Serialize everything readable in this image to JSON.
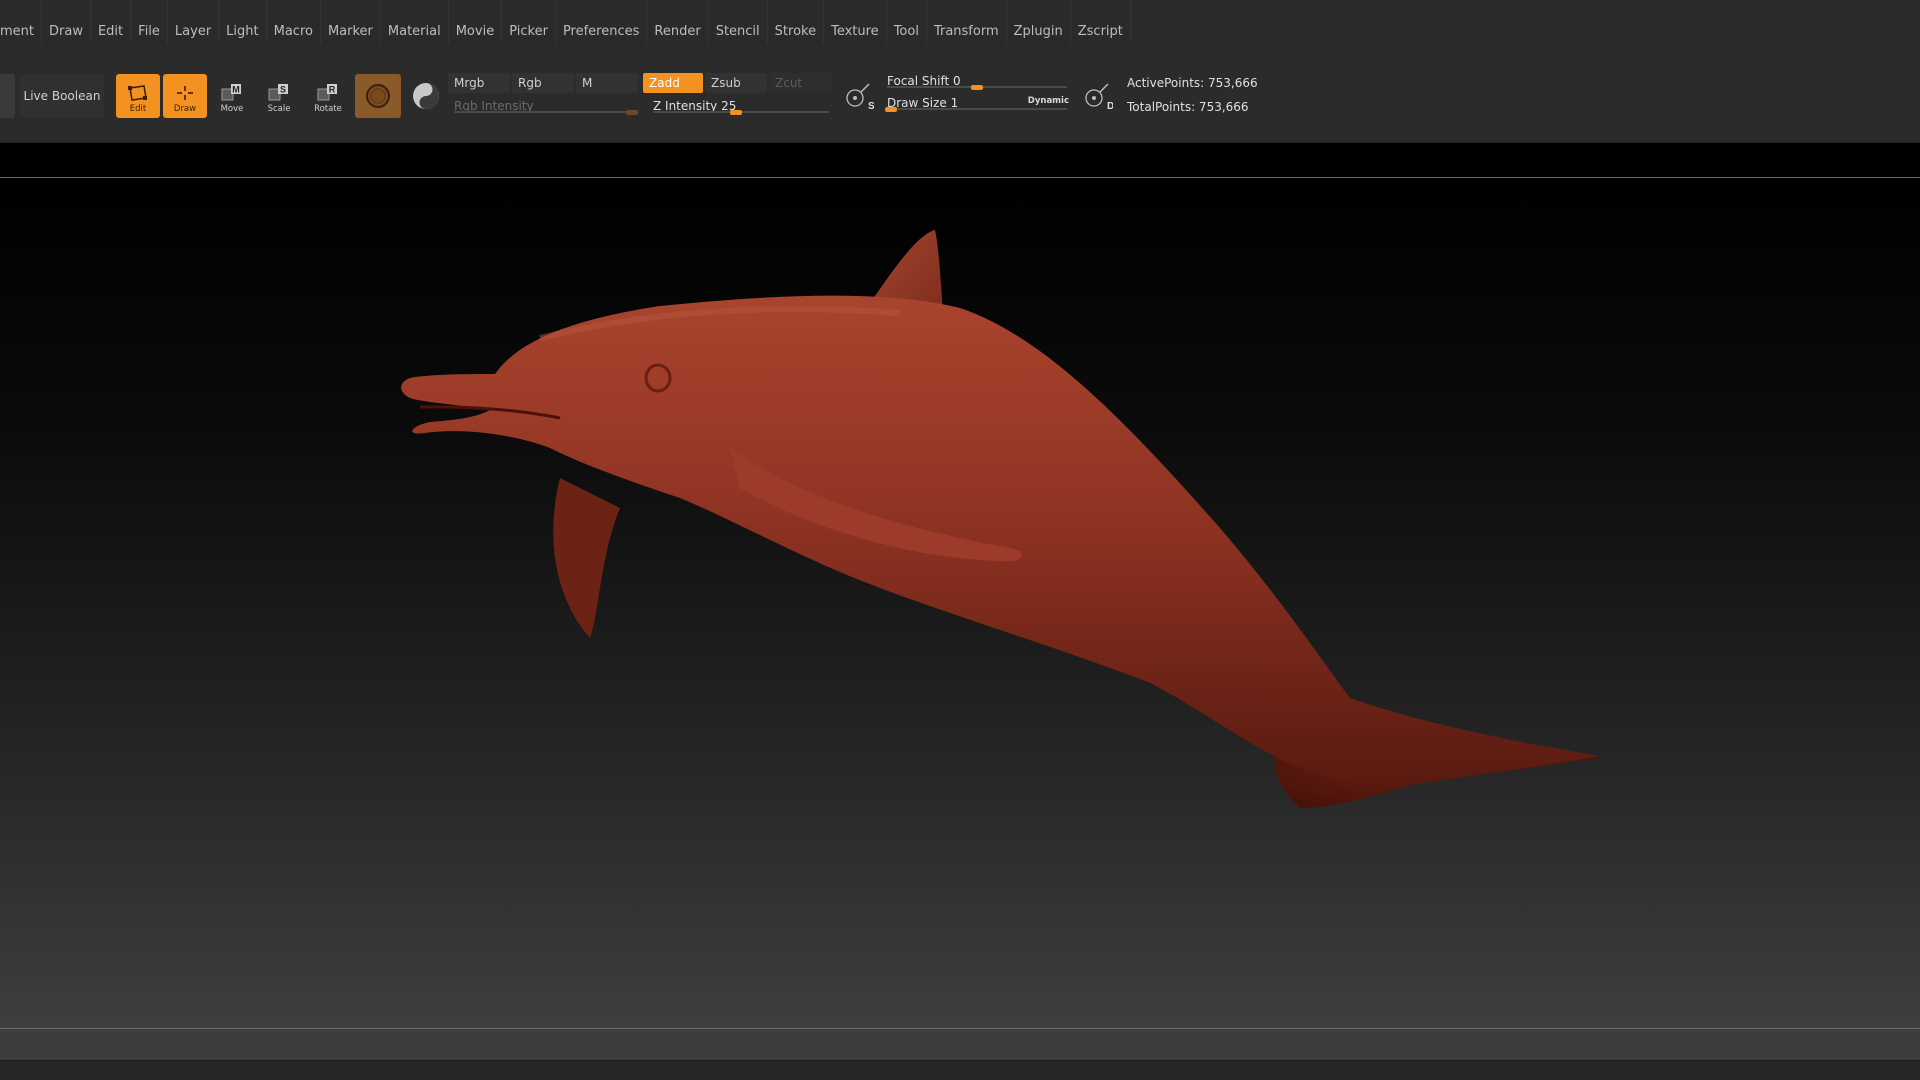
{
  "menu": [
    "ment",
    "Draw",
    "Edit",
    "File",
    "Layer",
    "Light",
    "Macro",
    "Marker",
    "Material",
    "Movie",
    "Picker",
    "Preferences",
    "Render",
    "Stencil",
    "Stroke",
    "Texture",
    "Tool",
    "Transform",
    "Zplugin",
    "Zscript"
  ],
  "toolbar": {
    "live_boolean": "Live Boolean",
    "edit": "Edit",
    "draw": "Draw",
    "move": "Move",
    "scale": "Scale",
    "rotate": "Rotate",
    "mrgb": "Mrgb",
    "rgb": "Rgb",
    "m": "M",
    "rgb_intensity": "Rgb Intensity",
    "zadd": "Zadd",
    "zsub": "Zsub",
    "zcut": "Zcut",
    "z_intensity": "Z Intensity 25",
    "focal_shift": "Focal Shift 0",
    "draw_size": "Draw Size 1",
    "dynamic": "Dynamic",
    "active_points": "ActivePoints: 753,666",
    "total_points": "TotalPoints: 753,666"
  },
  "icons": {
    "move_letter": "M",
    "scale_letter": "S",
    "rotate_letter": "R",
    "s_letter": "S",
    "d_letter": "D"
  },
  "colors": {
    "accent": "#f39221",
    "model": "#8e3322"
  }
}
